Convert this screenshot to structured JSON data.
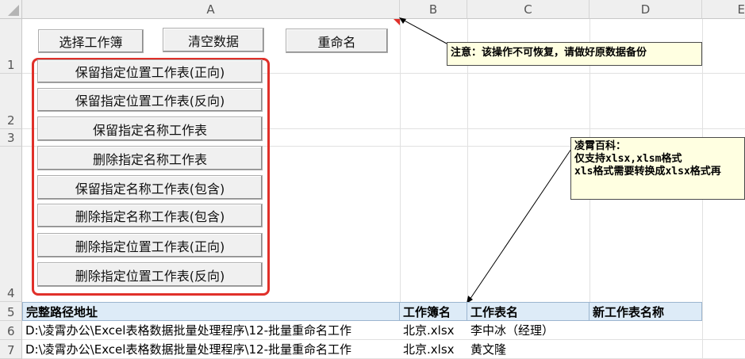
{
  "columns": [
    "A",
    "B",
    "C",
    "D",
    "E"
  ],
  "rows": [
    "1",
    "2",
    "3",
    "4",
    "5",
    "6",
    "7"
  ],
  "top_buttons": [
    "选择工作簿",
    "清空数据",
    "重命名"
  ],
  "panel_buttons": [
    "保留指定位置工作表(正向)",
    "保留指定位置工作表(反向)",
    "保留指定名称工作表",
    "删除指定名称工作表",
    "保留指定名称工作表(包含)",
    "删除指定名称工作表(包含)",
    "删除指定位置工作表(正向)",
    "删除指定位置工作表(反向)"
  ],
  "notes": {
    "warning": "注意：该操作不可恢复，请做好原数据备份",
    "info": "凌霄百科：\n仅支持xlsx,xlsm格式\nxls格式需要转换成xlsx格式再"
  },
  "table": {
    "headers": [
      "完整路径地址",
      "工作簿名",
      "工作表名",
      "新工作表名称"
    ],
    "rows": [
      [
        "D:\\凌霄办公\\Excel表格数据批量处理程序\\12-批量重命名工作",
        "北京.xlsx",
        "李中冰（经理）",
        ""
      ],
      [
        "D:\\凌霄办公\\Excel表格数据批量处理程序\\12-批量重命名工作",
        "北京.xlsx",
        "黄文隆",
        ""
      ]
    ]
  },
  "colors": {
    "highlight_border": "#e0302a",
    "header_fill": "#ddebf7",
    "note_fill": "#ffffe1"
  }
}
